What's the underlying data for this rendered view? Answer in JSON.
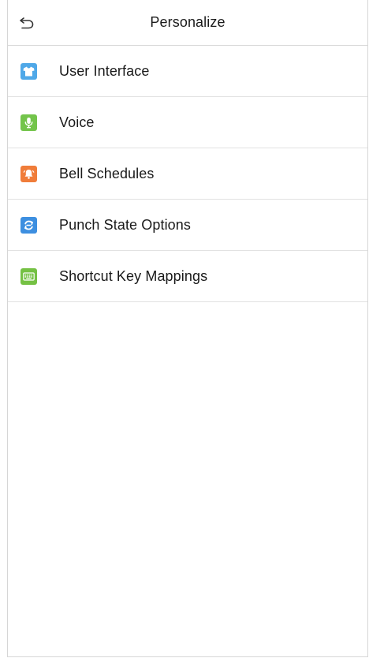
{
  "header": {
    "title": "Personalize",
    "back_icon": "back-arrow-icon"
  },
  "menu": {
    "items": [
      {
        "label": "User Interface",
        "icon": "tshirt-icon",
        "color": "#4fa8e8"
      },
      {
        "label": "Voice",
        "icon": "microphone-icon",
        "color": "#73c44b"
      },
      {
        "label": "Bell Schedules",
        "icon": "bell-icon",
        "color": "#f07d3a"
      },
      {
        "label": "Punch State Options",
        "icon": "punch-state-icon",
        "color": "#3d8fe0"
      },
      {
        "label": "Shortcut Key Mappings",
        "icon": "keyboard-icon",
        "color": "#75c144"
      }
    ]
  }
}
